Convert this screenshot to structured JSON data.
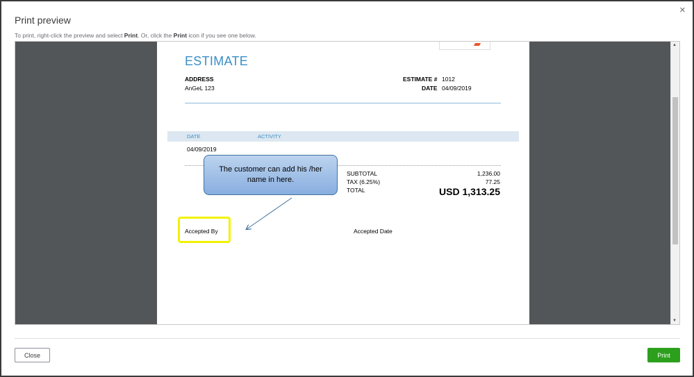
{
  "dialog": {
    "title": "Print preview",
    "close_glyph": "×",
    "hint_prefix": "To print, right-click the preview and select ",
    "hint_print_word": "Print",
    "hint_middle": ". Or, click the ",
    "hint_print_word2": "Print",
    "hint_suffix": " icon if you see one below."
  },
  "estimate": {
    "title": "ESTIMATE",
    "address_label": "ADDRESS",
    "address_value": "AnGeL 123",
    "estimate_no_label": "ESTIMATE #",
    "estimate_no_value": "1012",
    "date_label": "DATE",
    "date_value": "04/09/2019",
    "table": {
      "headers": [
        "DATE",
        "ACTIVITY"
      ],
      "rows": [
        [
          "04/09/2019",
          ""
        ]
      ]
    },
    "subtotal_label": "SUBTOTAL",
    "subtotal_value": "1,236.00",
    "tax_label": "TAX (6.25%)",
    "tax_value": "77.25",
    "total_label": "TOTAL",
    "total_value": "USD 1,313.25",
    "accepted_by_label": "Accepted By",
    "accepted_date_label": "Accepted Date"
  },
  "annotation": {
    "callout_text": "The customer can add his /her name in here."
  },
  "footer": {
    "close_label": "Close",
    "print_label": "Print"
  },
  "colors": {
    "accent_blue": "#3b8fc7",
    "print_green": "#2ca01c",
    "highlight_yellow": "#f2f200"
  }
}
